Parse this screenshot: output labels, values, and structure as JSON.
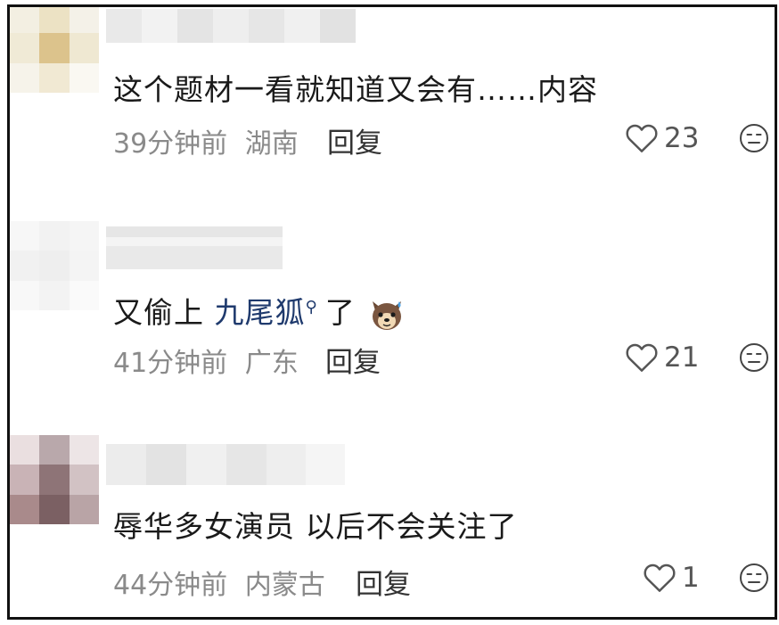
{
  "comments": [
    {
      "text": "这个题材一看就知道又会有……内容",
      "time": "39分钟前",
      "location": "湖南",
      "reply_label": "回复",
      "likes": "23"
    },
    {
      "text_prefix": "又偷上",
      "link_text": "九尾狐",
      "link_icon": "search-icon",
      "text_suffix": "了",
      "emoji": "dog-sweat-emoji",
      "time": "41分钟前",
      "location": "广东",
      "reply_label": "回复",
      "likes": "21"
    },
    {
      "text": "辱华多女演员 以后不会关注了",
      "time": "44分钟前",
      "location": "内蒙古",
      "reply_label": "回复",
      "likes": "1"
    }
  ],
  "colors": {
    "text": "#1a1a1a",
    "meta": "#8a8a8a",
    "link": "#1f3a6d",
    "border": "#111111"
  }
}
